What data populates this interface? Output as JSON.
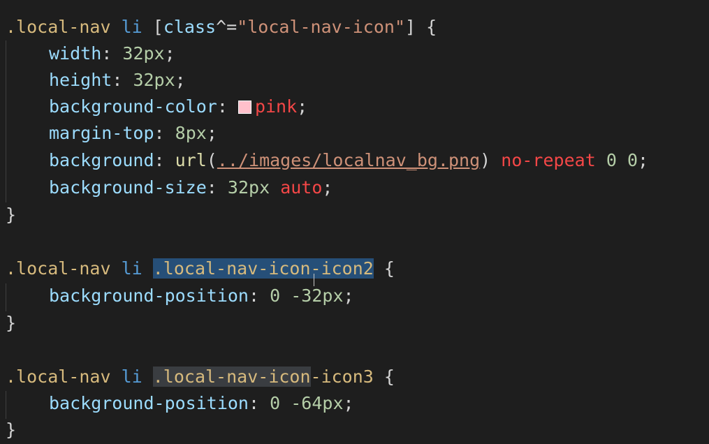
{
  "colors": {
    "background": "#1e1e1e",
    "selector": "#d7ba7d",
    "tag": "#569cd6",
    "property": "#9cdcfe",
    "number": "#b5cea8",
    "string": "#ce9178",
    "keyword": "#f44747",
    "selection": "#264f78",
    "match_highlight": "#3a3d41",
    "swatch_pink": "#ffc0cb"
  },
  "block1": {
    "selector_class": ".local-nav",
    "selector_tag": "li",
    "bracket_open": "[",
    "attr_name": "class",
    "attr_op": "^=",
    "attr_value": "\"local-nav-icon\"",
    "bracket_close": "]",
    "brace_open": "{",
    "width_prop": "width",
    "width_num": "32",
    "width_unit": "px",
    "height_prop": "height",
    "height_num": "32",
    "height_unit": "px",
    "bgcolor_prop": "background-color",
    "bgcolor_val": "pink",
    "margin_prop": "margin-top",
    "margin_num": "8",
    "margin_unit": "px",
    "bg_prop": "background",
    "bg_func": "url",
    "bg_paren_open": "(",
    "bg_url": "../images/localnav_bg.png",
    "bg_paren_close": ")",
    "bg_repeat": "no-repeat",
    "bg_x": "0",
    "bg_y": "0",
    "bgsize_prop": "background-size",
    "bgsize_num": "32",
    "bgsize_unit": "px",
    "bgsize_auto": "auto",
    "brace_close": "}"
  },
  "block2": {
    "selector_class": ".local-nav",
    "selector_tag": "li",
    "sub_selector_a": ".local-nav-ico",
    "sub_selector_b": "n",
    "sub_selector_c": "-icon2",
    "brace_open": "{",
    "pos_prop": "background-position",
    "pos_x": "0",
    "pos_y": "-32",
    "pos_unit": "px",
    "brace_close": "}"
  },
  "block3": {
    "selector_class": ".local-nav",
    "selector_tag": "li",
    "sub_selector_a": ".local-nav-icon",
    "sub_selector_b": "-icon3",
    "brace_open": "{",
    "pos_prop": "background-position",
    "pos_x": "0",
    "pos_y": "-64",
    "pos_unit": "px",
    "brace_close": "}"
  },
  "punct": {
    "colon": ":",
    "semicolon": ";",
    "space": " "
  }
}
